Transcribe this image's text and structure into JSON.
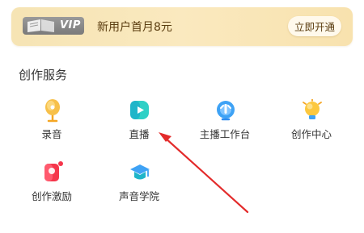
{
  "vip": {
    "badge": "VIP",
    "promo": "新用户首月8元",
    "button": "立即开通"
  },
  "section": {
    "title": "创作服务"
  },
  "services": [
    {
      "label": "录音",
      "icon": "microphone-icon"
    },
    {
      "label": "直播",
      "icon": "live-play-icon"
    },
    {
      "label": "主播工作台",
      "icon": "workbench-icon"
    },
    {
      "label": "创作中心",
      "icon": "lightbulb-icon"
    },
    {
      "label": "创作激励",
      "icon": "reward-icon"
    },
    {
      "label": "声音学院",
      "icon": "graduation-cap-icon"
    }
  ],
  "colors": {
    "banner": "#f7e5b6",
    "brand_orange": "#f5a623",
    "brand_teal": "#26c6c6",
    "brand_blue": "#2d8cf0",
    "brand_red": "#f5364b",
    "arrow": "#e32b2b"
  }
}
